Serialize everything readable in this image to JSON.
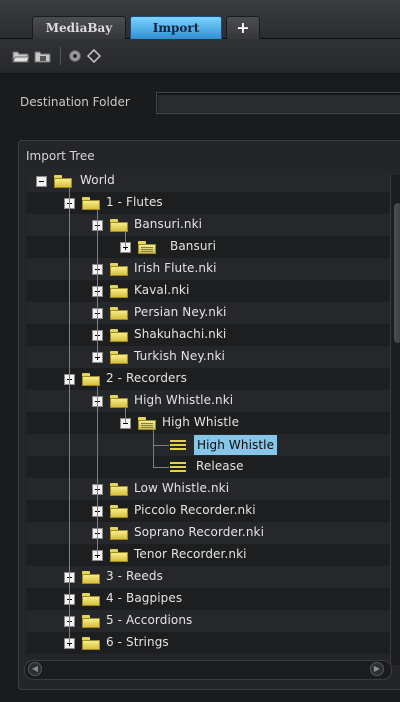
{
  "tabs": {
    "mediabay": "MediaBay",
    "import": "Import",
    "add": "+"
  },
  "toolbar": {
    "icons": [
      "open-folder-icon",
      "save-folder-icon",
      "browse-icon",
      "tag-icon"
    ]
  },
  "destination": {
    "label": "Destination Folder",
    "value": ""
  },
  "tree": {
    "title": "Import Tree",
    "nodes": [
      {
        "label": "World"
      },
      {
        "label": "1 - Flutes"
      },
      {
        "label": "Bansuri.nki"
      },
      {
        "label": "Bansuri"
      },
      {
        "label": "Irish Flute.nki"
      },
      {
        "label": "Kaval.nki"
      },
      {
        "label": "Persian Ney.nki"
      },
      {
        "label": "Shakuhachi.nki"
      },
      {
        "label": "Turkish Ney.nki"
      },
      {
        "label": "2 - Recorders"
      },
      {
        "label": "High Whistle.nki"
      },
      {
        "label": "High Whistle"
      },
      {
        "label": "High Whistle"
      },
      {
        "label": "Release"
      },
      {
        "label": "Low Whistle.nki"
      },
      {
        "label": "Piccolo Recorder.nki"
      },
      {
        "label": "Soprano Recorder.nki"
      },
      {
        "label": "Tenor Recorder.nki"
      },
      {
        "label": "3 - Reeds"
      },
      {
        "label": "4 - Bagpipes"
      },
      {
        "label": "5 - Accordions"
      },
      {
        "label": "6 - Strings"
      }
    ]
  },
  "colors": {
    "accent": "#87c6e8",
    "tab_active": "#2f8fd4",
    "folder": "#e4d65a"
  }
}
